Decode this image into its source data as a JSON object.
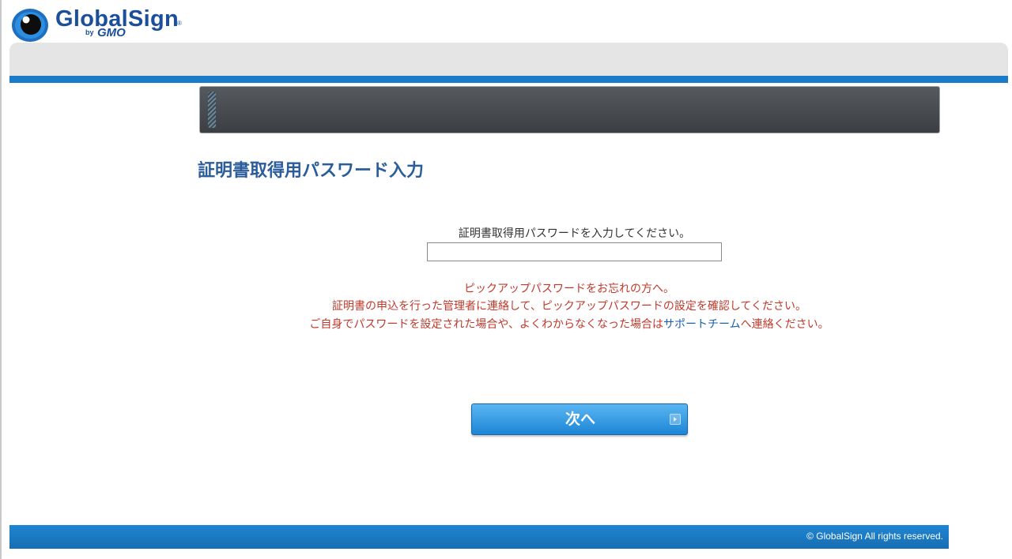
{
  "brand": {
    "name": "GlobalSign",
    "registered_mark": "®",
    "by": "by",
    "parent": "GMO",
    "colors": {
      "logo": "#1b4f9c",
      "accent_strip": "#1a7bc9",
      "title": "#2a5d9a",
      "notice": "#c0392b",
      "link": "#1d5fb0",
      "button": "#1c86d6"
    }
  },
  "page": {
    "title": "証明書取得用パスワード入力"
  },
  "form": {
    "password_label": "証明書取得用パスワードを入力してください。",
    "password_value": ""
  },
  "notice": {
    "line1": "ピックアップパスワードをお忘れの方へ。",
    "line2": "証明書の申込を行った管理者に連絡して、ピックアップパスワードの設定を確認してください。",
    "line3_before": "ご自身でパスワードを設定された場合や、よくわからなくなった場合は",
    "line3_link": "サポートチーム",
    "line3_after": "へ連絡ください。"
  },
  "actions": {
    "next_label": "次へ",
    "next_icon": "arrow-right-icon"
  },
  "footer": {
    "copyright": "© GlobalSign All rights reserved."
  }
}
